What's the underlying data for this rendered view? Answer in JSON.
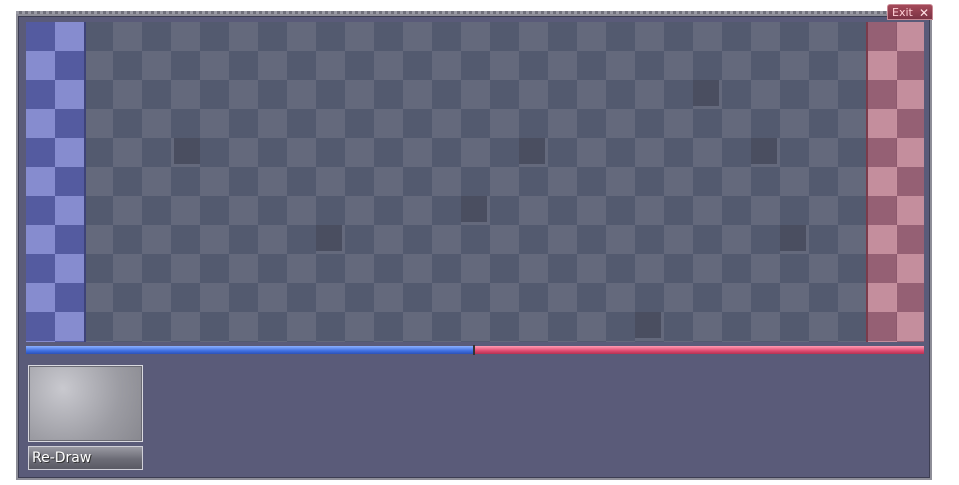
{
  "header": {
    "exit_label": "Exit"
  },
  "controls": {
    "redraw_label": "Re-Draw"
  },
  "health": {
    "blue_fraction": 0.5,
    "red_fraction": 0.5
  },
  "colors": {
    "blue_team": "#3f6fe0",
    "red_team": "#e04a70",
    "panel": "#5a5b79"
  },
  "icons": {
    "exit": "close-icon",
    "hand_card": "card-back"
  }
}
